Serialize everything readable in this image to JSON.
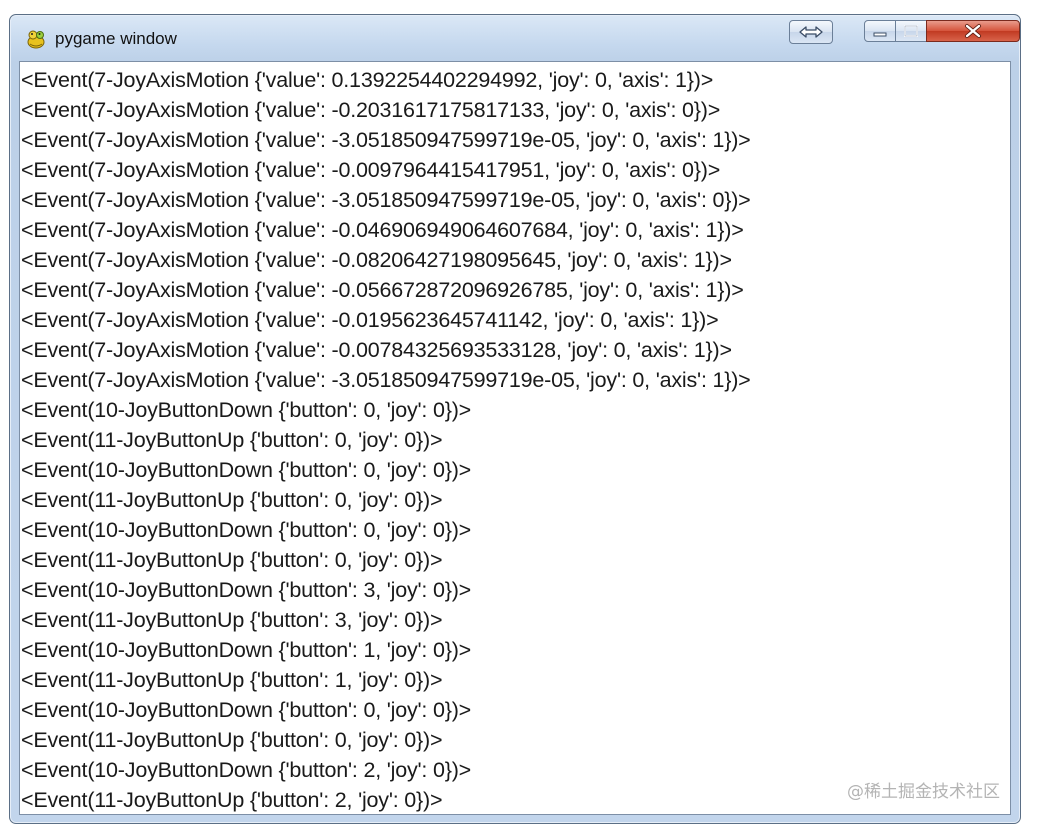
{
  "window": {
    "title": "pygame window",
    "icon": "pygame-snake-icon"
  },
  "controls": {
    "restore_icon": "double-arrow-icon",
    "minimize_icon": "minimize-icon",
    "maximize_icon": "maximize-icon",
    "close_icon": "close-icon",
    "close_color": "#c8432b"
  },
  "log": {
    "lines": [
      "<Event(7-JoyAxisMotion {'value': 0.1392254402294992, 'joy': 0, 'axis': 1})>",
      "<Event(7-JoyAxisMotion {'value': -0.2031617175817133, 'joy': 0, 'axis': 0})>",
      "<Event(7-JoyAxisMotion {'value': -3.051850947599719e-05, 'joy': 0, 'axis': 1})>",
      "<Event(7-JoyAxisMotion {'value': -0.0097964415417951, 'joy': 0, 'axis': 0})>",
      "<Event(7-JoyAxisMotion {'value': -3.051850947599719e-05, 'joy': 0, 'axis': 0})>",
      "<Event(7-JoyAxisMotion {'value': -0.046906949064607684, 'joy': 0, 'axis': 1})>",
      "<Event(7-JoyAxisMotion {'value': -0.08206427198095645, 'joy': 0, 'axis': 1})>",
      "<Event(7-JoyAxisMotion {'value': -0.056672872096926785, 'joy': 0, 'axis': 1})>",
      "<Event(7-JoyAxisMotion {'value': -0.0195623645741142, 'joy': 0, 'axis': 1})>",
      "<Event(7-JoyAxisMotion {'value': -0.00784325693533128, 'joy': 0, 'axis': 1})>",
      "<Event(7-JoyAxisMotion {'value': -3.051850947599719e-05, 'joy': 0, 'axis': 1})>",
      "<Event(10-JoyButtonDown {'button': 0, 'joy': 0})>",
      "<Event(11-JoyButtonUp {'button': 0, 'joy': 0})>",
      "<Event(10-JoyButtonDown {'button': 0, 'joy': 0})>",
      "<Event(11-JoyButtonUp {'button': 0, 'joy': 0})>",
      "<Event(10-JoyButtonDown {'button': 0, 'joy': 0})>",
      "<Event(11-JoyButtonUp {'button': 0, 'joy': 0})>",
      "<Event(10-JoyButtonDown {'button': 3, 'joy': 0})>",
      "<Event(11-JoyButtonUp {'button': 3, 'joy': 0})>",
      "<Event(10-JoyButtonDown {'button': 1, 'joy': 0})>",
      "<Event(11-JoyButtonUp {'button': 1, 'joy': 0})>",
      "<Event(10-JoyButtonDown {'button': 0, 'joy': 0})>",
      "<Event(11-JoyButtonUp {'button': 0, 'joy': 0})>",
      "<Event(10-JoyButtonDown {'button': 2, 'joy': 0})>",
      "<Event(11-JoyButtonUp {'button': 2, 'joy': 0})>"
    ]
  },
  "watermark": "@稀土掘金技术社区"
}
